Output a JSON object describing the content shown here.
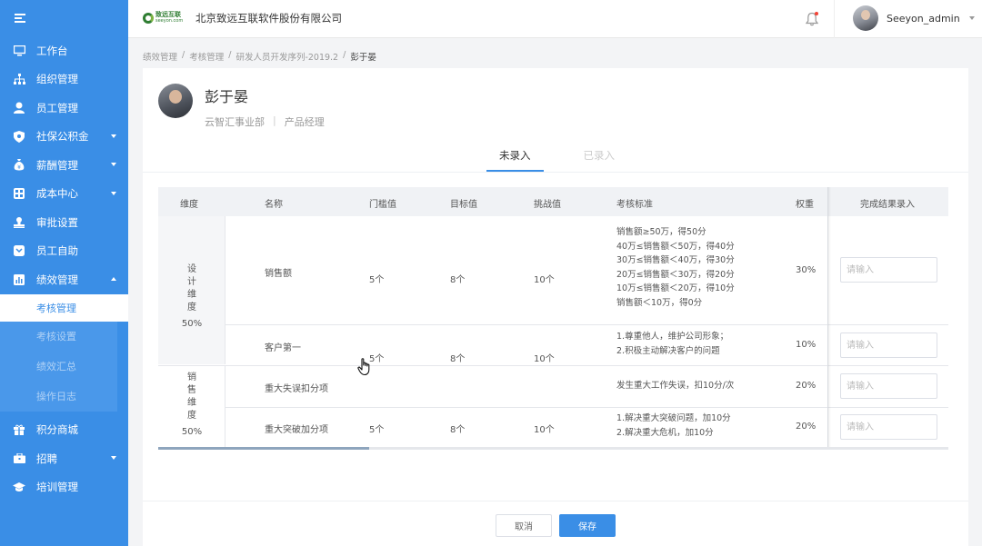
{
  "sidebar": {
    "items": [
      {
        "label": "工作台",
        "icon": "monitor-icon",
        "caret": ""
      },
      {
        "label": "组织管理",
        "icon": "org-chart-icon",
        "caret": ""
      },
      {
        "label": "员工管理",
        "icon": "user-icon",
        "caret": ""
      },
      {
        "label": "社保公积金",
        "icon": "shield-icon",
        "caret": "down"
      },
      {
        "label": "薪酬管理",
        "icon": "money-bag-icon",
        "caret": "down"
      },
      {
        "label": "成本中心",
        "icon": "grid-icon",
        "caret": "down"
      },
      {
        "label": "审批设置",
        "icon": "stamp-icon",
        "caret": ""
      },
      {
        "label": "员工自助",
        "icon": "self-service-icon",
        "caret": ""
      },
      {
        "label": "绩效管理",
        "icon": "chart-icon",
        "caret": "up"
      }
    ],
    "sub_items": [
      "考核管理",
      "考核设置",
      "绩效汇总",
      "操作日志"
    ],
    "bottom_items": [
      {
        "label": "积分商城",
        "icon": "gift-icon",
        "caret": ""
      },
      {
        "label": "招聘",
        "icon": "briefcase-icon",
        "caret": "down"
      },
      {
        "label": "培训管理",
        "icon": "graduation-cap-icon",
        "caret": ""
      }
    ]
  },
  "header": {
    "logo_text": "致远互联",
    "logo_sub": "seeyon.com",
    "company": "北京致远互联软件股份有限公司",
    "username": "Seeyon_admin"
  },
  "breadcrumb": [
    "绩效管理",
    "考核管理",
    "研发人员开发序列-2019.2",
    "彭于晏"
  ],
  "profile": {
    "name": "彭于晏",
    "department": "云智汇事业部",
    "position": "产品经理"
  },
  "tabs": [
    "未录入",
    "已录入"
  ],
  "table": {
    "headers": {
      "dimension": "维度",
      "name": "名称",
      "threshold": "门槛值",
      "target": "目标值",
      "challenge": "挑战值",
      "standard": "考核标准",
      "weight": "权重",
      "result": "完成结果录入"
    },
    "dimensions": [
      {
        "chars": [
          "设",
          "计",
          "维",
          "度"
        ],
        "percent": "50%"
      },
      {
        "chars": [
          "销",
          "售",
          "维",
          "度"
        ],
        "percent": "50%"
      }
    ],
    "rows": [
      {
        "name": "销售额",
        "threshold": "5个",
        "target": "8个",
        "challenge": "10个",
        "standard": [
          "销售额≥50万，得50分",
          "40万≤销售额＜50万，得40分",
          "30万≤销售额＜40万，得30分",
          "20万≤销售额＜30万，得20分",
          "10万≤销售额＜20万，得10分",
          "销售额＜10万，得0分"
        ],
        "weight": "30%",
        "placeholder": "请输入"
      },
      {
        "name": "客户第一",
        "threshold": "5个",
        "target": "8个",
        "challenge": "10个",
        "standard": [
          "1.尊重他人，维护公司形象；",
          "2.积极主动解决客户的问题"
        ],
        "weight": "10%",
        "placeholder": "请输入"
      },
      {
        "name": "重大失误扣分项",
        "threshold": "",
        "target": "",
        "challenge": "",
        "standard": [
          "发生重大工作失误，扣10分/次"
        ],
        "weight": "20%",
        "placeholder": "请输入"
      },
      {
        "name": "重大突破加分项",
        "threshold": "5个",
        "target": "8个",
        "challenge": "10个",
        "standard": [
          "1.解决重大突破问题，加10分",
          "2.解决重大危机，加10分"
        ],
        "weight": "20%",
        "placeholder": "请输入"
      }
    ]
  },
  "footer": {
    "cancel": "取消",
    "save": "保存"
  },
  "colors": {
    "sidebar": "#3a8ee6",
    "accent": "#3a8ee6"
  }
}
